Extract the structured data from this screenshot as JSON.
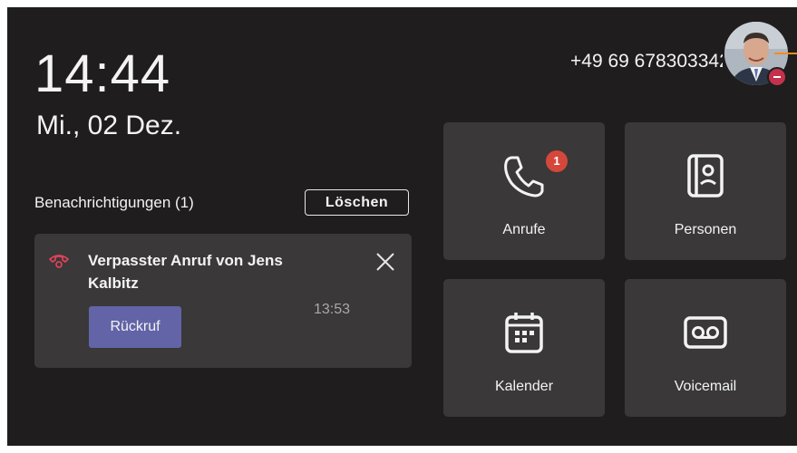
{
  "status": {
    "time": "14:44",
    "date": "Mi., 02 Dez.",
    "phone_number": "+49 69 678303342",
    "presence": "do-not-disturb"
  },
  "notifications": {
    "heading": "Benachrichtigungen (1)",
    "clear_label": "Löschen",
    "items": [
      {
        "icon": "missed-call-icon",
        "title": "Verpasster Anruf von Jens Kalbitz",
        "time": "13:53",
        "action_label": "Rückruf"
      }
    ]
  },
  "tiles": [
    {
      "label": "Anrufe",
      "icon": "phone-icon",
      "badge": "1"
    },
    {
      "label": "Personen",
      "icon": "contacts-icon"
    },
    {
      "label": "Kalender",
      "icon": "calendar-icon"
    },
    {
      "label": "Voicemail",
      "icon": "voicemail-icon"
    }
  ],
  "colors": {
    "background": "#1f1d1d",
    "card": "#3a3838",
    "accent": "#6264a7",
    "badge": "#d6473b",
    "missed_call": "#d9435a",
    "presence_dnd": "#c4314b"
  }
}
